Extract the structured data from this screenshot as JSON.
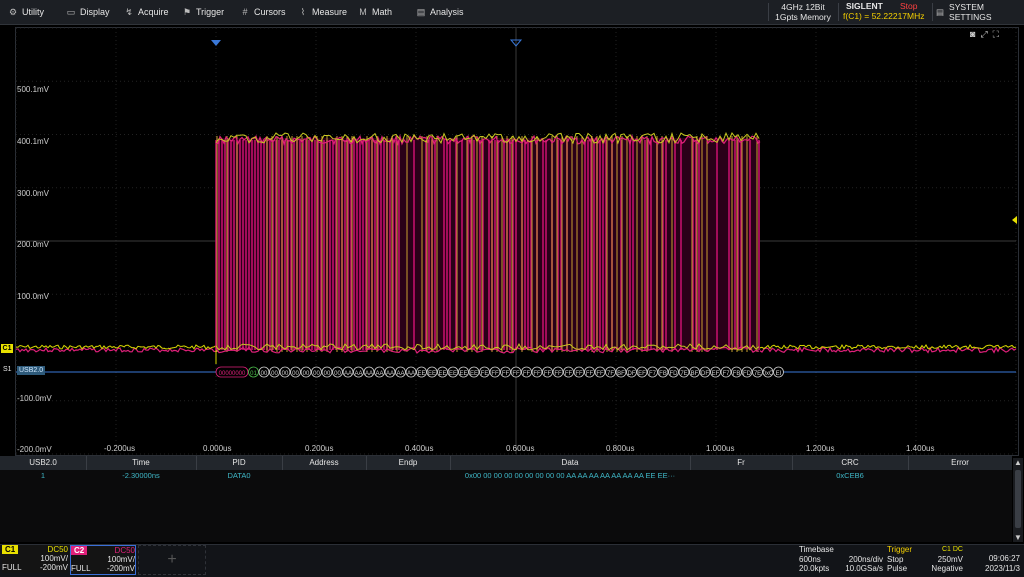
{
  "menu": [
    {
      "icon": "gear-icon",
      "glyph": "⚙",
      "label": "Utility"
    },
    {
      "icon": "display-icon",
      "glyph": "▭",
      "label": "Display"
    },
    {
      "icon": "acquire-icon",
      "glyph": "↯",
      "label": "Acquire"
    },
    {
      "icon": "trigger-icon",
      "glyph": "⚑",
      "label": "Trigger"
    },
    {
      "icon": "cursors-icon",
      "glyph": "#",
      "label": "Cursors"
    },
    {
      "icon": "measure-icon",
      "glyph": "⌇",
      "label": "Measure"
    },
    {
      "icon": "math-icon",
      "glyph": "M",
      "label": "Math"
    },
    {
      "icon": "analysis-icon",
      "glyph": "▤",
      "label": "Analysis"
    }
  ],
  "spec": {
    "line1": "4GHz 12Bit",
    "line2": "1Gpts Memory"
  },
  "brand": "SIGLENT",
  "run_state": "Stop",
  "freq_readout": "f(C1) = 52.22217MHz",
  "system_settings": "SYSTEM SETTINGS",
  "y_ticks": [
    "500.1mV",
    "400.1mV",
    "300.0mV",
    "200.0mV",
    "100.0mV",
    "-100.0mV",
    "-200.0mV"
  ],
  "x_ticks": [
    "-0.200us",
    "0.000us",
    "0.200us",
    "0.400us",
    "0.600us",
    "0.800us",
    "1.000us",
    "1.200us",
    "1.400us"
  ],
  "ch1_marker": "C1",
  "s1_label": "S1",
  "bus_tag": "USB2.0",
  "decode_bytes": [
    "00000000",
    "01",
    "00",
    "00",
    "00",
    "00",
    "00",
    "00",
    "00",
    "00",
    "AA",
    "AA",
    "AA",
    "AA",
    "AA",
    "AA",
    "AA",
    "EE",
    "EE",
    "EE",
    "EE",
    "EE",
    "EE",
    "FE",
    "FF",
    "FF",
    "FF",
    "FF",
    "FF",
    "FF",
    "FF",
    "FF",
    "FF",
    "FF",
    "FF",
    "7F",
    "BF",
    "DF",
    "EF",
    "F7",
    "FB",
    "FD",
    "7E",
    "BF",
    "DF",
    "EF",
    "F7",
    "FB",
    "FD",
    "7E",
    "0xC",
    "EI"
  ],
  "table": {
    "headers": [
      "USB2.0",
      "Time",
      "PID",
      "Address",
      "Endp",
      "Data",
      "Fr",
      "CRC",
      "Error"
    ],
    "row": [
      "1",
      "-2.30000ns",
      "DATA0",
      "",
      "",
      "0x00 00 00 00 00 00 00 00 00 AA AA AA AA AA AA AA EE EE···",
      "",
      "0xCEB6",
      ""
    ]
  },
  "ch1": {
    "name": "C1",
    "coupling": "DC50",
    "scale": "100mV/",
    "bw": "FULL",
    "offset": "-200mV"
  },
  "ch2": {
    "name": "C2",
    "coupling": "DC50",
    "scale": "100mV/",
    "bw": "FULL",
    "offset": "-200mV"
  },
  "timebase": {
    "title": "Timebase",
    "delay": "600ns",
    "scale": "200ns/div",
    "points": "20.0kpts",
    "rate": "10.0GSa/s"
  },
  "trigger": {
    "title": "Trigger",
    "source": "C1 DC",
    "state": "Stop",
    "level": "250mV",
    "type": "Pulse",
    "polarity": "Negative"
  },
  "clock": {
    "time": "09:06:27",
    "date": "2023/11/3"
  },
  "colors": {
    "ch1": "#e8e000",
    "ch2": "#e0207a",
    "decode": "#3fb8c8"
  }
}
